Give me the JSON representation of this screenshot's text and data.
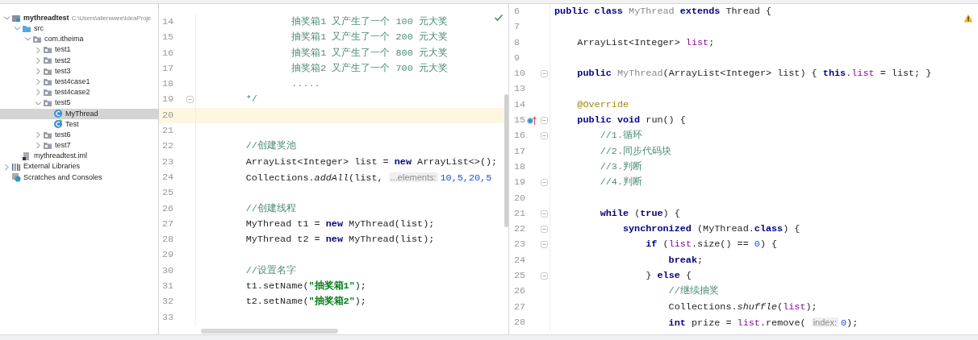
{
  "project_tree": [
    {
      "label": "mythreadtest",
      "path": "C:\\Users\\alienware\\IdeaProje",
      "kind": "module",
      "expanded": true,
      "selected": false,
      "children": [
        {
          "label": "src",
          "kind": "source",
          "expanded": true,
          "selected": false,
          "children": [
            {
              "label": "com.itheima",
              "kind": "package",
              "expanded": true,
              "selected": false,
              "children": [
                {
                  "label": "test1",
                  "kind": "package",
                  "expanded": false,
                  "selected": false
                },
                {
                  "label": "test2",
                  "kind": "package",
                  "expanded": false,
                  "selected": false
                },
                {
                  "label": "test3",
                  "kind": "package",
                  "expanded": false,
                  "selected": false
                },
                {
                  "label": "test4case1",
                  "kind": "package",
                  "expanded": false,
                  "selected": false
                },
                {
                  "label": "test4case2",
                  "kind": "package",
                  "expanded": false,
                  "selected": false
                },
                {
                  "label": "test5",
                  "kind": "package",
                  "expanded": true,
                  "selected": false,
                  "children": [
                    {
                      "label": "MyThread",
                      "kind": "class",
                      "selected": true
                    },
                    {
                      "label": "Test",
                      "kind": "main-class",
                      "selected": false
                    }
                  ]
                },
                {
                  "label": "test6",
                  "kind": "package",
                  "expanded": false,
                  "selected": false
                },
                {
                  "label": "test7",
                  "kind": "package",
                  "expanded": false,
                  "selected": false
                }
              ]
            }
          ]
        },
        {
          "label": "mythreadtest.iml",
          "kind": "file",
          "selected": false
        }
      ]
    },
    {
      "label": "External Libraries",
      "kind": "libraries",
      "expanded": false,
      "selected": false
    },
    {
      "label": "Scratches and Consoles",
      "kind": "scratches",
      "selected": false
    }
  ],
  "editors": [
    {
      "kind": "ok",
      "lines": [
        {
          "number": "14",
          "segments": [
            {
              "kind": "comment",
              "text": "                抽奖箱1 又产生了一个 100 元大奖"
            }
          ]
        },
        {
          "number": "15",
          "segments": [
            {
              "kind": "comment",
              "text": "                抽奖箱1 又产生了一个 200 元大奖"
            }
          ]
        },
        {
          "number": "16",
          "segments": [
            {
              "kind": "comment",
              "text": "                抽奖箱1 又产生了一个 800 元大奖"
            }
          ]
        },
        {
          "number": "17",
          "segments": [
            {
              "kind": "comment",
              "text": "                抽奖箱2 又产生了一个 700 元大奖"
            }
          ]
        },
        {
          "number": "18",
          "segments": [
            {
              "kind": "comment",
              "text": "                ....."
            }
          ]
        },
        {
          "number": "19",
          "fold": true,
          "segments": [
            {
              "kind": "comment",
              "text": "        */"
            }
          ]
        },
        {
          "number": "20",
          "current": true
        },
        {
          "number": "21"
        },
        {
          "number": "22",
          "segments": [
            {
              "kind": "comment",
              "text": "        //创建奖池"
            }
          ]
        },
        {
          "number": "23",
          "segments": [
            {
              "kind": "plain",
              "text": "        ArrayList<Integer> list = "
            },
            {
              "kind": "keyword",
              "text": "new"
            },
            {
              "kind": "plain",
              "text": " ArrayList<>();"
            }
          ]
        },
        {
          "number": "24",
          "segments": [
            {
              "kind": "plain",
              "text": "        Collections."
            },
            {
              "kind": "static",
              "text": "addAll"
            },
            {
              "kind": "plain",
              "text": "(list, "
            },
            {
              "kind": "hint",
              "text": "...elements:"
            },
            {
              "kind": "number",
              "text": "10,5,20,5"
            }
          ]
        },
        {
          "number": "25"
        },
        {
          "number": "26",
          "segments": [
            {
              "kind": "comment",
              "text": "        //创建线程"
            }
          ]
        },
        {
          "number": "27",
          "segments": [
            {
              "kind": "plain",
              "text": "        MyThread t1 = "
            },
            {
              "kind": "keyword",
              "text": "new"
            },
            {
              "kind": "plain",
              "text": " MyThread(list);"
            }
          ]
        },
        {
          "number": "28",
          "segments": [
            {
              "kind": "plain",
              "text": "        MyThread t2 = "
            },
            {
              "kind": "keyword",
              "text": "new"
            },
            {
              "kind": "plain",
              "text": " MyThread(list);"
            }
          ]
        },
        {
          "number": "29"
        },
        {
          "number": "30",
          "segments": [
            {
              "kind": "comment",
              "text": "        //设置名字"
            }
          ]
        },
        {
          "number": "31",
          "segments": [
            {
              "kind": "plain",
              "text": "        t1.setName("
            },
            {
              "kind": "string",
              "text": "\"抽奖箱1\""
            },
            {
              "kind": "plain",
              "text": ");"
            }
          ]
        },
        {
          "number": "32",
          "segments": [
            {
              "kind": "plain",
              "text": "        t2.setName("
            },
            {
              "kind": "string",
              "text": "\"抽奖箱2\""
            },
            {
              "kind": "plain",
              "text": ");"
            }
          ]
        },
        {
          "number": "33"
        }
      ]
    },
    {
      "kind": "warning",
      "lines": [
        {
          "number": "6",
          "segments": [
            {
              "kind": "keyword",
              "text": "public class "
            },
            {
              "kind": "unused",
              "text": "MyThread"
            },
            {
              "kind": "keyword",
              "text": " extends"
            },
            {
              "kind": "plain",
              "text": " Thread {"
            }
          ]
        },
        {
          "number": "7"
        },
        {
          "number": "8",
          "segments": [
            {
              "kind": "plain",
              "text": "    ArrayList<Integer> "
            },
            {
              "kind": "field",
              "text": "list"
            },
            {
              "kind": "plain",
              "text": ";"
            }
          ]
        },
        {
          "number": "9"
        },
        {
          "number": "10",
          "fold": true,
          "segments": [
            {
              "kind": "keyword",
              "text": "    public "
            },
            {
              "kind": "unused",
              "text": "MyThread"
            },
            {
              "kind": "plain",
              "text": "(ArrayList<Integer> list) { "
            },
            {
              "kind": "keyword",
              "text": "this"
            },
            {
              "kind": "plain",
              "text": "."
            },
            {
              "kind": "field",
              "text": "list"
            },
            {
              "kind": "plain",
              "text": " = list; }"
            }
          ]
        },
        {
          "number": "13"
        },
        {
          "number": "14",
          "segments": [
            {
              "kind": "annotation",
              "text": "    @Override"
            }
          ]
        },
        {
          "number": "15",
          "fold": true,
          "override": true,
          "segments": [
            {
              "kind": "keyword",
              "text": "    public void"
            },
            {
              "kind": "plain",
              "text": " run() {"
            }
          ]
        },
        {
          "number": "16",
          "fold": true,
          "segments": [
            {
              "kind": "comment",
              "text": "        //1.循环"
            }
          ]
        },
        {
          "number": "17",
          "segments": [
            {
              "kind": "comment",
              "text": "        //2.同步代码块"
            }
          ]
        },
        {
          "number": "18",
          "segments": [
            {
              "kind": "comment",
              "text": "        //3.判断"
            }
          ]
        },
        {
          "number": "19",
          "fold": true,
          "segments": [
            {
              "kind": "comment",
              "text": "        //4.判断"
            }
          ]
        },
        {
          "number": "20"
        },
        {
          "number": "21",
          "fold": true,
          "segments": [
            {
              "kind": "keyword",
              "text": "        while"
            },
            {
              "kind": "plain",
              "text": " ("
            },
            {
              "kind": "keyword",
              "text": "true"
            },
            {
              "kind": "plain",
              "text": ") {"
            }
          ]
        },
        {
          "number": "22",
          "fold": true,
          "segments": [
            {
              "kind": "keyword",
              "text": "            synchronized"
            },
            {
              "kind": "plain",
              "text": " (MyThread."
            },
            {
              "kind": "keyword",
              "text": "class"
            },
            {
              "kind": "plain",
              "text": ") {"
            }
          ]
        },
        {
          "number": "23",
          "fold": true,
          "segments": [
            {
              "kind": "keyword",
              "text": "                if"
            },
            {
              "kind": "plain",
              "text": " ("
            },
            {
              "kind": "field",
              "text": "list"
            },
            {
              "kind": "plain",
              "text": ".size() == "
            },
            {
              "kind": "number",
              "text": "0"
            },
            {
              "kind": "plain",
              "text": ") {"
            }
          ]
        },
        {
          "number": "24",
          "segments": [
            {
              "kind": "keyword",
              "text": "                    break"
            },
            {
              "kind": "plain",
              "text": ";"
            }
          ]
        },
        {
          "number": "25",
          "fold": true,
          "segments": [
            {
              "kind": "plain",
              "text": "                } "
            },
            {
              "kind": "keyword",
              "text": "else"
            },
            {
              "kind": "plain",
              "text": " {"
            }
          ]
        },
        {
          "number": "26",
          "segments": [
            {
              "kind": "comment",
              "text": "                    //继续抽奖"
            }
          ]
        },
        {
          "number": "27",
          "segments": [
            {
              "kind": "plain",
              "text": "                    Collections."
            },
            {
              "kind": "static",
              "text": "shuffle"
            },
            {
              "kind": "plain",
              "text": "("
            },
            {
              "kind": "field",
              "text": "list"
            },
            {
              "kind": "plain",
              "text": ");"
            }
          ]
        },
        {
          "number": "28",
          "segments": [
            {
              "kind": "keyword",
              "text": "                    int"
            },
            {
              "kind": "plain",
              "text": " prize = "
            },
            {
              "kind": "field",
              "text": "list"
            },
            {
              "kind": "plain",
              "text": ".remove( "
            },
            {
              "kind": "hint",
              "text": "index:"
            },
            {
              "kind": "number",
              "text": "0"
            },
            {
              "kind": "plain",
              "text": ");"
            }
          ]
        }
      ]
    }
  ]
}
